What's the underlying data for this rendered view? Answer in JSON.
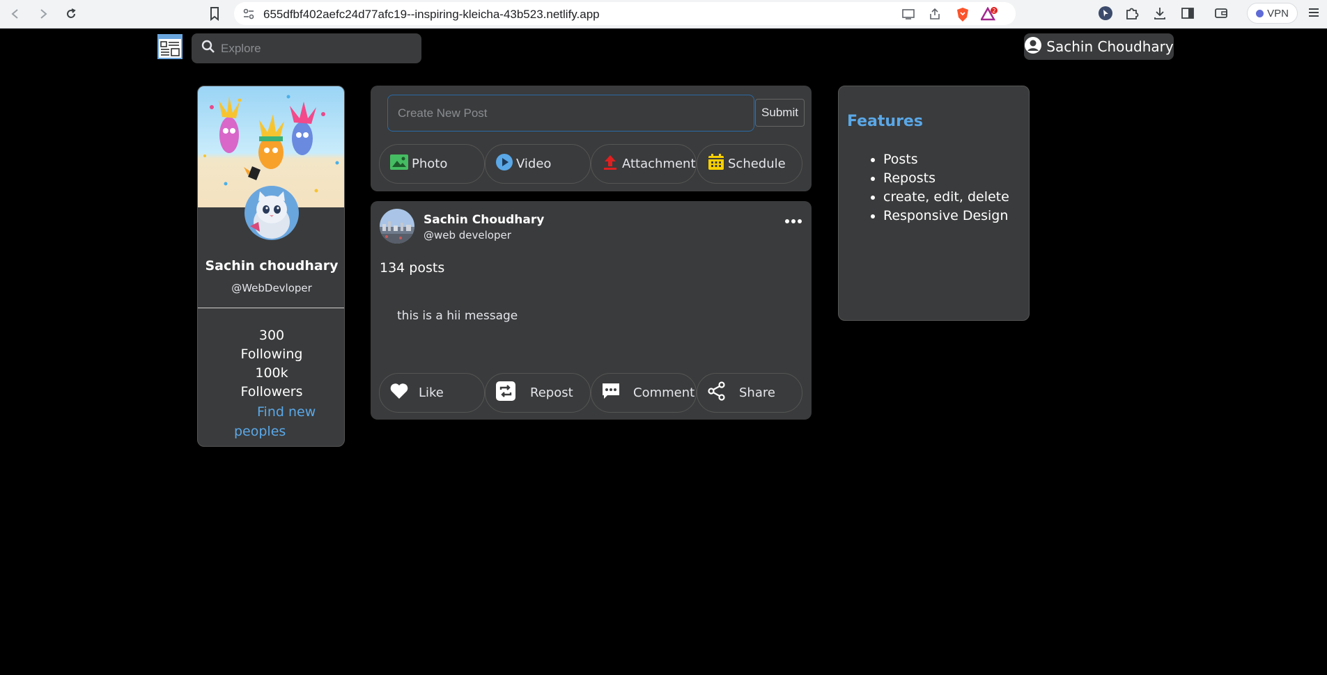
{
  "browser": {
    "url": "655dfbf402aefc24d77afc19--inspiring-kleicha-43b523.netlify.app",
    "vpn_label": "VPN",
    "extension_badge": "2"
  },
  "header": {
    "search_placeholder": "Explore",
    "user_name": "Sachin Choudhary"
  },
  "profile": {
    "name": "Sachin choudhary",
    "handle": "@WebDevloper",
    "following_count": "300",
    "following_label": "Following",
    "followers_count": "100k",
    "followers_label": "Followers",
    "find_link": "Find new peoples"
  },
  "composer": {
    "placeholder": "Create New Post",
    "submit_label": "Submit",
    "photo_label": "Photo",
    "video_label": "Video",
    "attachment_label": "Attachment",
    "schedule_label": "Schedule"
  },
  "post": {
    "author": "Sachin Choudhary",
    "handle": "@web developer",
    "count": "134 posts",
    "message": "this is a hii message",
    "like_label": "Like",
    "repost_label": "Repost",
    "comment_label": "Comment",
    "share_label": "Share"
  },
  "features": {
    "title": "Features",
    "items": [
      "Posts",
      "Reposts",
      "create, edit, delete",
      "Responsive Design"
    ]
  },
  "colors": {
    "accent_blue": "#5aa8e8",
    "card_bg": "#3a3b3c",
    "photo_icon": "#45bd62",
    "video_icon": "#5aa8e8",
    "attachment_icon": "#e02020",
    "schedule_icon": "#f7d000"
  }
}
